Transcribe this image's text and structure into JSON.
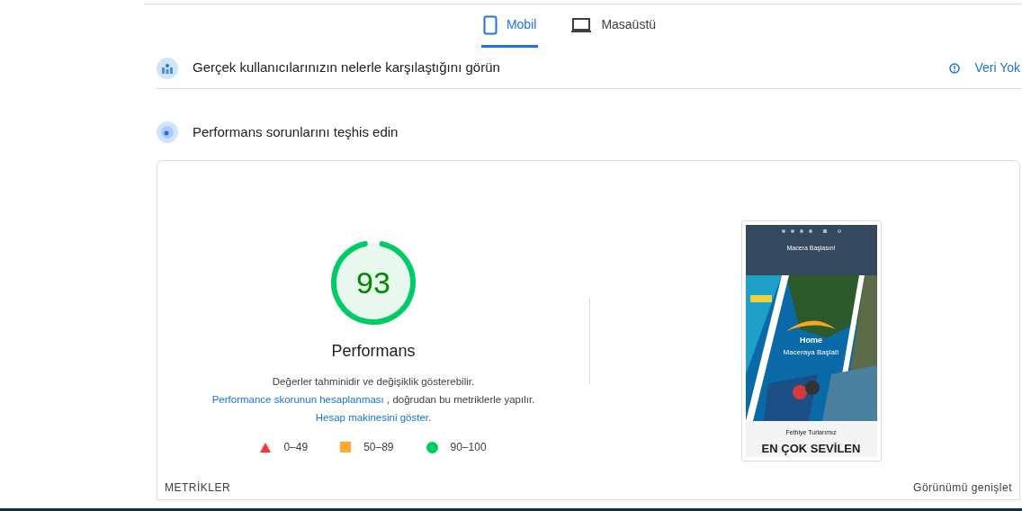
{
  "tabs": [
    {
      "label": "Mobil",
      "kind": "phone",
      "selected": true
    },
    {
      "label": "Masaüstü",
      "kind": "desktop",
      "selected": false
    }
  ],
  "field_data": {
    "title": "Gerçek kullanıcılarınızın nelerle karşılaştığını görün",
    "status": "Veri Yok"
  },
  "diagnose": {
    "title": "Performans sorunlarını teşhis edin"
  },
  "score": {
    "value": "93",
    "level": 0.93,
    "label": "Performans",
    "description": [
      "Değerler tahminidir ve değişiklik gösterebilir. ",
      {
        "link": "Performance skorunun hesaplanması"
      },
      " , doğrudan bu metriklerle yapılır. ",
      {
        "link": "Hesap makinesini göster."
      }
    ]
  },
  "legend": [
    {
      "kind": "triangle",
      "color": "#ff3333",
      "label": "0–49"
    },
    {
      "kind": "square",
      "color": "#ffaa33",
      "label": "50–89"
    },
    {
      "kind": "circle",
      "color": "#00cc66",
      "label": "90–100"
    }
  ],
  "preview": {
    "header": "Macera Başlasın!",
    "hero_title": "Home",
    "hero_subtitle": "Maceraya Başlat!",
    "section_kicker": "Fethiye Turlarımız",
    "section_title": "EN ÇOK SEVİLEN"
  },
  "metrics": {
    "title": "METRİKLER",
    "expand": "Görünümü genişlet"
  }
}
